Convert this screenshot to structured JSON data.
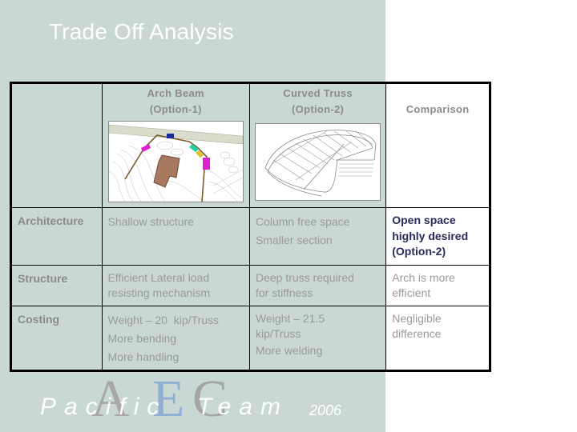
{
  "slide": {
    "title": "Trade Off Analysis",
    "colors": {
      "panel_bg": "#c9d8d5",
      "emphasis_text": "#2a2a5c",
      "body_text": "#9a9a9a",
      "logo_a": "#a8a8a8",
      "logo_e": "#8fb0d4",
      "logo_c": "#a5a5a5"
    }
  },
  "table": {
    "headers": {
      "option1_line1": "Arch Beam",
      "option1_line2": "(Option-1)",
      "option2_line1": "Curved Truss",
      "option2_line2": "(Option-2)",
      "comparison": "Comparison"
    },
    "images": {
      "option1": "arch-beam-site-plan",
      "option2": "curved-truss-wireframe"
    },
    "rows": [
      {
        "label": "Architecture",
        "option1": [
          "Shallow structure"
        ],
        "option2": [
          "Column free space",
          "Smaller section"
        ],
        "comparison": [
          "Open space",
          "highly desired",
          "(Option-2)"
        ]
      },
      {
        "label": "Structure",
        "option1": [
          "Efficient Lateral load",
          "resisting mechanism"
        ],
        "option2": [
          "Deep truss required",
          "for stiffness"
        ],
        "comparison": [
          "Arch is more",
          "efficient"
        ]
      },
      {
        "label": "Costing",
        "option1": [
          "Weight – 20  kip/Truss",
          "More bending",
          "More handling"
        ],
        "option2": [
          "Weight – 21.5",
          "kip/Truss",
          "More welding"
        ],
        "comparison": [
          "Negligible",
          "difference"
        ]
      }
    ]
  },
  "footer": {
    "word1": "Pacific",
    "word2": "Team",
    "logo_letters": [
      "A",
      "E",
      "C"
    ],
    "year": "2006"
  }
}
